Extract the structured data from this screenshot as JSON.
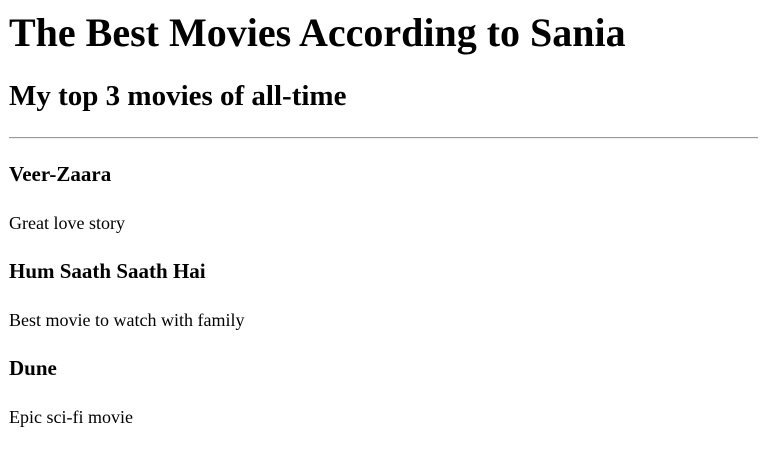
{
  "page": {
    "title": "The Best Movies According to Sania",
    "subtitle": "My top 3 movies of all-time"
  },
  "movies": [
    {
      "title": "Veer-Zaara",
      "description": "Great love story"
    },
    {
      "title": "Hum Saath Saath Hai",
      "description": "Best movie to watch with family"
    },
    {
      "title": "Dune",
      "description": "Epic sci-fi movie"
    }
  ]
}
